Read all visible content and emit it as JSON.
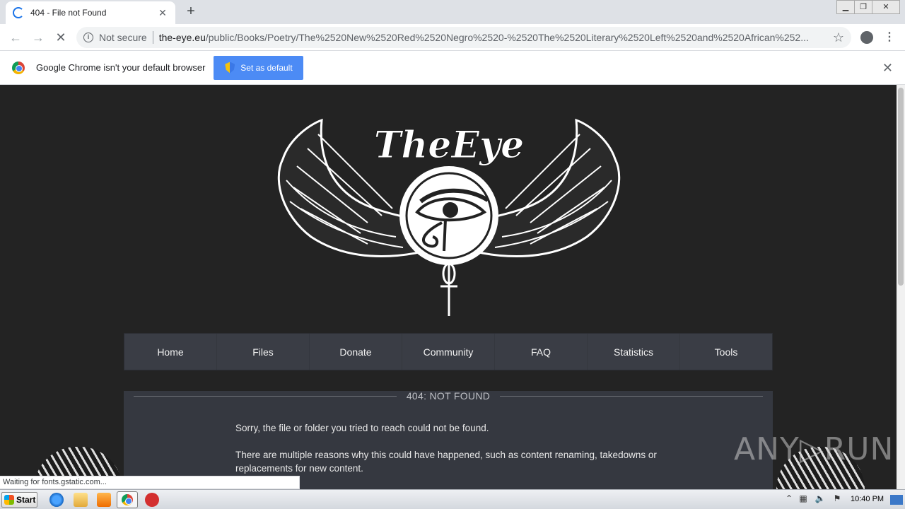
{
  "browser": {
    "tab_title": "404 - File not Found",
    "new_tab": "+",
    "security_label": "Not secure",
    "url_host": "the-eye.eu",
    "url_path": "/public/Books/Poetry/The%2520New%2520Red%2520Negro%2520-%2520The%2520Literary%2520Left%2520and%2520African%252...",
    "infobar_message": "Google Chrome isn't your default browser",
    "infobar_button": "Set as default",
    "status_text": "Waiting for fonts.gstatic.com..."
  },
  "site": {
    "logo_text": "TheEye",
    "nav": [
      "Home",
      "Files",
      "Donate",
      "Community",
      "FAQ",
      "Statistics",
      "Tools"
    ],
    "panel_heading": "404: NOT FOUND",
    "paragraph1": "Sorry, the file or folder you tried to reach could not be found.",
    "paragraph2": "There are multiple reasons why this could have happened, such as content renaming, takedowns or replacements for new content."
  },
  "watermark": "ANY▷RUN",
  "taskbar": {
    "start_label": "Start",
    "clock": "10:40 PM"
  },
  "colors": {
    "page_bg": "#232323",
    "nav_bg": "#3a3d45",
    "panel_bg": "#353840",
    "accent_button": "#4c8bf5"
  }
}
